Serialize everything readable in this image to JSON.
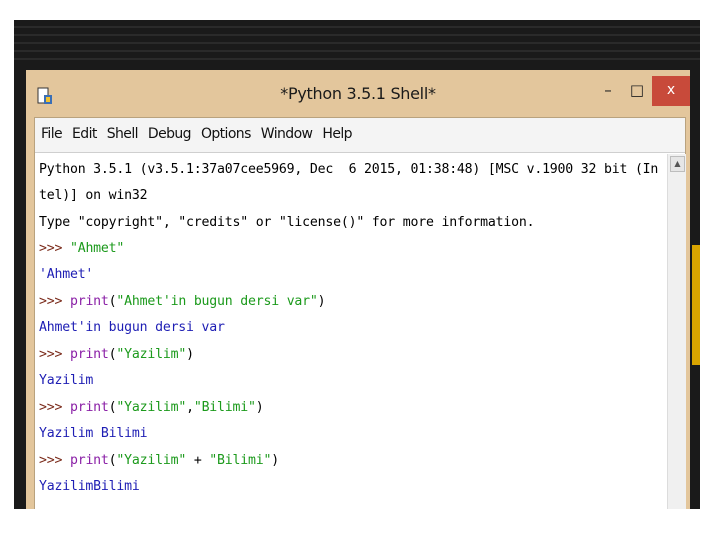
{
  "window": {
    "title": "*Python 3.5.1 Shell*",
    "minimize": "–",
    "maximize": "□",
    "close": "x"
  },
  "menu": [
    "File",
    "Edit",
    "Shell",
    "Debug",
    "Options",
    "Window",
    "Help"
  ],
  "shell": {
    "banner_1": "Python 3.5.1 (v3.5.1:37a07cee5969, Dec  6 2015, 01:38:48) [MSC v.1900 32 bit (In",
    "banner_2": "tel)] on win32",
    "banner_3": "Type \"copyright\", \"credits\" or \"license()\" for more information.",
    "prompt": ">>> ",
    "print_kw": "print",
    "cmd1_str": "\"Ahmet\"",
    "out1": "'Ahmet'",
    "cmd2_arg": "\"Ahmet'in bugun dersi var\"",
    "out2": "Ahmet'in bugun dersi var",
    "cmd3_arg": "\"Yazilim\"",
    "out3": "Yazilim",
    "cmd4_arg1": "\"Yazilim\"",
    "cmd4_arg2": "\"Bilimi\"",
    "out4": "Yazilim Bilimi",
    "cmd5_arg1": "\"Yazilim\"",
    "cmd5_plus": " + ",
    "cmd5_arg2": "\"Bilimi\"",
    "out5": "YazilimBilimi",
    "open_paren": "(",
    "close_paren": ")",
    "comma": ","
  },
  "colors": {
    "prompt": "#7a2a1a",
    "keyword": "#8a1fa6",
    "string": "#1c9a1c",
    "output": "#1e1eb4",
    "close_button": "#c84a3a",
    "title_bar": "#e3c69c"
  }
}
